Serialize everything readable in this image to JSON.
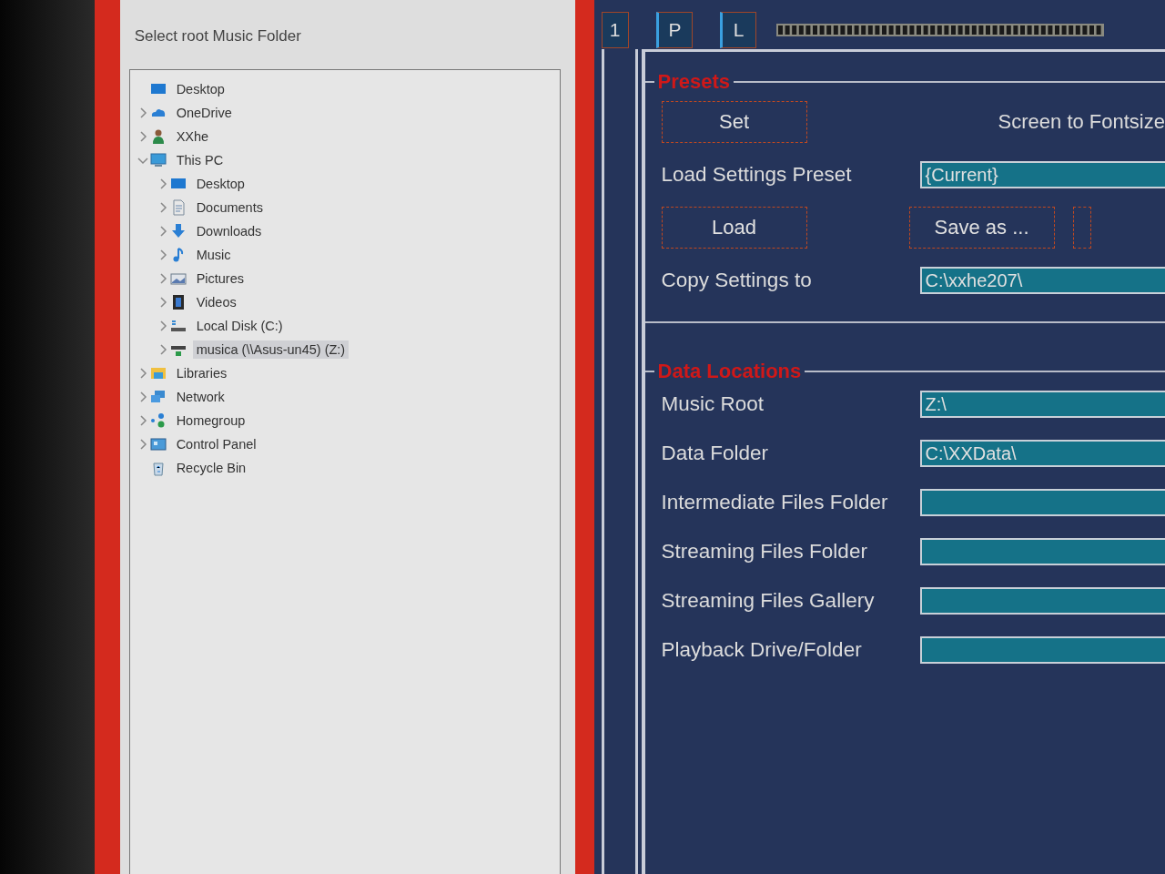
{
  "dialog": {
    "title": "Select root Music Folder",
    "tree": [
      {
        "label": "Desktop",
        "kind": "desktop",
        "selected": false,
        "children": [
          {
            "label": "OneDrive",
            "kind": "cloud",
            "selected": false,
            "expanded": false
          },
          {
            "label": "XXhe",
            "kind": "user",
            "selected": false,
            "expanded": false
          },
          {
            "label": "This PC",
            "kind": "pc",
            "selected": false,
            "expanded": true,
            "children": [
              {
                "label": "Desktop",
                "kind": "desktop",
                "selected": false,
                "expanded": false
              },
              {
                "label": "Documents",
                "kind": "documents",
                "selected": false,
                "expanded": false
              },
              {
                "label": "Downloads",
                "kind": "downloads",
                "selected": false,
                "expanded": false
              },
              {
                "label": "Music",
                "kind": "music",
                "selected": false,
                "expanded": false
              },
              {
                "label": "Pictures",
                "kind": "pictures",
                "selected": false,
                "expanded": false
              },
              {
                "label": "Videos",
                "kind": "videos",
                "selected": false,
                "expanded": false
              },
              {
                "label": "Local Disk (C:)",
                "kind": "drive",
                "selected": false,
                "expanded": false
              },
              {
                "label": "musica (\\\\Asus-un45) (Z:)",
                "kind": "netdrive",
                "selected": true,
                "expanded": false
              }
            ]
          },
          {
            "label": "Libraries",
            "kind": "libraries",
            "selected": false,
            "expanded": false
          },
          {
            "label": "Network",
            "kind": "network",
            "selected": false,
            "expanded": false
          },
          {
            "label": "Homegroup",
            "kind": "homegroup",
            "selected": false,
            "expanded": false
          },
          {
            "label": "Control Panel",
            "kind": "control-panel",
            "selected": false,
            "expanded": false
          },
          {
            "label": "Recycle Bin",
            "kind": "recycle-bin",
            "selected": false
          }
        ]
      }
    ]
  },
  "app": {
    "tabs": [
      "1",
      "P",
      "L"
    ],
    "sections": [
      {
        "title": "Presets",
        "rows": [
          {
            "kind": "button-text",
            "button": "Set",
            "text": "Screen to Fontsize"
          },
          {
            "kind": "field",
            "label": "Load Settings Preset",
            "value": "{Current}"
          },
          {
            "kind": "buttons",
            "buttons": [
              "Load",
              "Save as ..."
            ],
            "cut_off_button": true
          },
          {
            "kind": "field",
            "label": "Copy Settings to",
            "value": "C:\\xxhe207\\"
          }
        ]
      },
      {
        "title": "Data Locations",
        "rows": [
          {
            "kind": "field",
            "label": "Music Root",
            "value": "Z:\\"
          },
          {
            "kind": "field",
            "label": "Data Folder",
            "value": "C:\\XXData\\"
          },
          {
            "kind": "field",
            "label": "Intermediate Files Folder"
          },
          {
            "kind": "field",
            "label": "Streaming Files Folder"
          },
          {
            "kind": "field",
            "label": "Streaming Files Gallery"
          },
          {
            "kind": "field",
            "label": "Playback Drive/Folder"
          }
        ]
      }
    ]
  }
}
